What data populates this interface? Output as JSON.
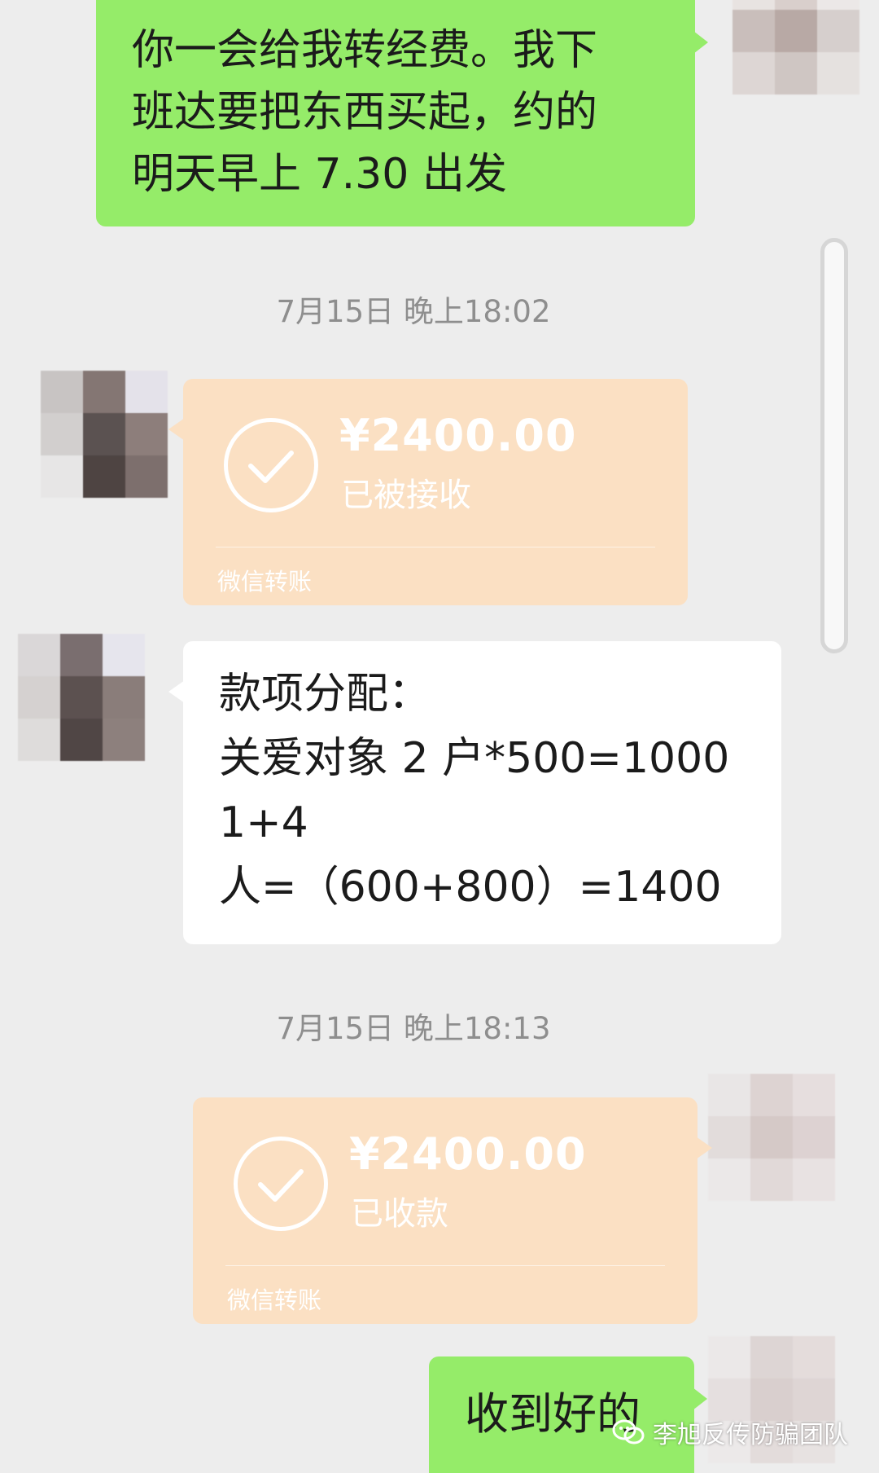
{
  "messages": {
    "first_text": "你一会给我转经费。我下\n班达要把东西买起，约的\n明天早上 7.30 出发",
    "ts1": "7月15日 晚上18:02",
    "transfer1": {
      "amount": "¥2400.00",
      "status": "已被接收",
      "label": "微信转账"
    },
    "breakdown_text": "款项分配：\n关爱对象 2 户*500=1000\n1+4\n人=（600+800）=1400",
    "ts2": "7月15日 晚上18:13",
    "transfer2": {
      "amount": "¥2400.00",
      "status": "已收款",
      "label": "微信转账"
    },
    "last_text": "收到好的"
  },
  "watermark": {
    "text": "李旭反传防骗团队",
    "icon": "wechat-official-account-icon"
  },
  "colors": {
    "chat_bg": "#ededed",
    "sent_bubble": "#95ec69",
    "received_bubble": "#ffffff",
    "transfer_bubble": "#fbe0c3"
  }
}
